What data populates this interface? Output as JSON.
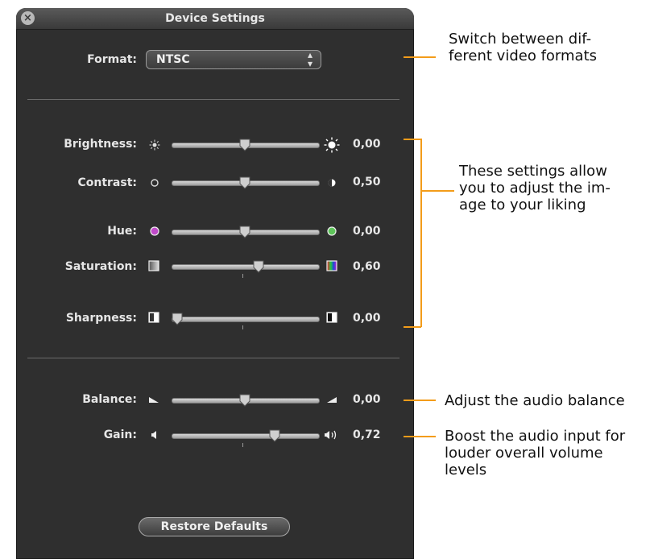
{
  "window": {
    "title": "Device Settings"
  },
  "format": {
    "label": "Format:",
    "value": "NTSC"
  },
  "sliders": [
    {
      "key": "brightness",
      "label": "Brightness:",
      "value": "0,00",
      "level": 0.5
    },
    {
      "key": "contrast",
      "label": "Contrast:",
      "value": "0,50",
      "level": 0.5
    },
    {
      "key": "hue",
      "label": "Hue:",
      "value": "0,00",
      "level": 0.5
    },
    {
      "key": "saturation",
      "label": "Saturation:",
      "value": "0,60",
      "level": 0.6
    },
    {
      "key": "sharpness",
      "label": "Sharpness:",
      "value": "0,00",
      "level": 0.0
    },
    {
      "key": "balance",
      "label": "Balance:",
      "value": "0,00",
      "level": 0.5
    },
    {
      "key": "gain",
      "label": "Gain:",
      "value": "0,72",
      "level": 0.72
    }
  ],
  "restore_button": "Restore Defaults",
  "annotations": {
    "format_note_line1": "Switch between dif-",
    "format_note_line2": "ferent video formats",
    "image_note_line1": "These settings allow",
    "image_note_line2": "you to adjust the im-",
    "image_note_line3": "age to your liking",
    "balance_note": "Adjust the audio balance",
    "gain_note_line1": "Boost the audio input for",
    "gain_note_line2": "louder overall volume",
    "gain_note_line3": "levels"
  },
  "colors": {
    "accent": "#f39c1a",
    "panel": "#2f2f2f"
  },
  "icons": [
    "close-icon",
    "brightness-low-icon",
    "brightness-high-icon",
    "contrast-low-icon",
    "contrast-high-icon",
    "hue-low-icon",
    "hue-high-icon",
    "saturation-low-icon",
    "saturation-high-icon",
    "sharpness-low-icon",
    "sharpness-high-icon",
    "balance-left-icon",
    "balance-right-icon",
    "volume-low-icon",
    "volume-high-icon"
  ]
}
